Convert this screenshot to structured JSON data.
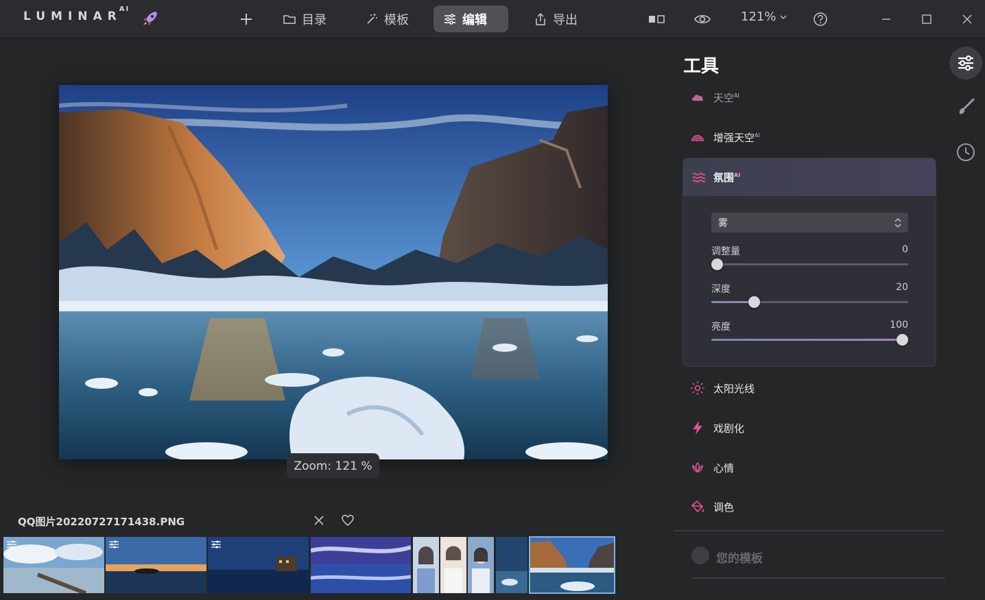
{
  "app": {
    "logo_text": "LUMINAR",
    "logo_sup": "AI",
    "logo_icon": "rocket-icon"
  },
  "toolbar": {
    "add_icon": "plus-icon",
    "catalog_label": "目录",
    "templates_label": "模板",
    "edit_label": "编辑",
    "export_label": "导出",
    "compare_icon": "compare-icon",
    "preview_icon": "eye-icon",
    "zoom_label": "121%",
    "help_icon": "help-icon",
    "window_controls": [
      "minimize-icon",
      "maximize-icon",
      "close-icon"
    ]
  },
  "canvas": {
    "zoom_overlay": "Zoom: 121 %"
  },
  "filmstrip": {
    "filename": "QQ图片20220727171438.PNG",
    "thumbnails": [
      {
        "name": "pier-clouds",
        "edited": true
      },
      {
        "name": "sunset-island",
        "edited": true
      },
      {
        "name": "lake-castle-night",
        "edited": true
      },
      {
        "name": "purple-lake-reflection",
        "edited": false
      },
      {
        "name": "portrait-1",
        "edited": false
      },
      {
        "name": "portrait-2",
        "edited": false
      },
      {
        "name": "portrait-3",
        "edited": false
      },
      {
        "name": "winter-blue",
        "edited": false
      },
      {
        "name": "yosemite-winter",
        "edited": false,
        "selected": true
      }
    ]
  },
  "tools": {
    "title": "工具",
    "sky": {
      "label": "天空",
      "sup": "AI"
    },
    "sky_enhancer": {
      "label": "增强天空",
      "sup": "AI"
    },
    "atmosphere": {
      "label": "氛围",
      "sup": "AI",
      "type_value": "雾",
      "sliders": [
        {
          "label": "调整量",
          "value": "0",
          "fraction": 0.0
        },
        {
          "label": "深度",
          "value": "20",
          "fraction": 0.2
        },
        {
          "label": "亮度",
          "value": "100",
          "fraction": 1.0
        }
      ]
    },
    "sun_rays": {
      "label": "太阳光线"
    },
    "dramatic": {
      "label": "戏剧化"
    },
    "mood": {
      "label": "心情"
    },
    "toning": {
      "label": "调色"
    },
    "your_templates": {
      "label": "您的模板"
    }
  },
  "rail": {
    "items": [
      "sliders-icon",
      "brush-icon",
      "history-icon"
    ],
    "active": "sliders-icon"
  },
  "colors": {
    "accent_pink": "#e84f9a",
    "active_tab_bg": "#505156",
    "panel_bg": "#252628"
  }
}
